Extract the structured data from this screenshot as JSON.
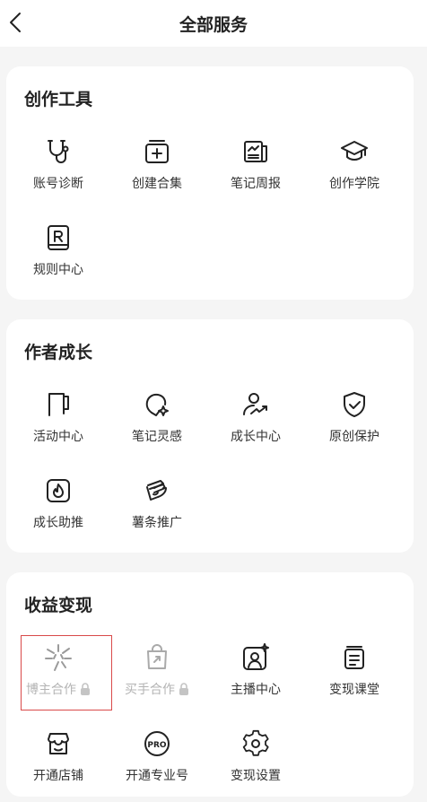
{
  "header": {
    "title": "全部服务",
    "back_icon": "chevron-left-icon"
  },
  "sections": [
    {
      "title": "创作工具",
      "items": [
        {
          "label": "账号诊断",
          "icon": "stethoscope-icon"
        },
        {
          "label": "创建合集",
          "icon": "collection-plus-icon"
        },
        {
          "label": "笔记周报",
          "icon": "report-chart-icon"
        },
        {
          "label": "创作学院",
          "icon": "graduation-cap-icon"
        },
        {
          "label": "规则中心",
          "icon": "rules-book-icon"
        }
      ]
    },
    {
      "title": "作者成长",
      "items": [
        {
          "label": "活动中心",
          "icon": "flag-icon"
        },
        {
          "label": "笔记灵感",
          "icon": "lightbulb-sparkle-icon"
        },
        {
          "label": "成长中心",
          "icon": "user-growth-icon"
        },
        {
          "label": "原创保护",
          "icon": "shield-check-icon"
        },
        {
          "label": "成长助推",
          "icon": "flame-badge-icon"
        },
        {
          "label": "薯条推广",
          "icon": "fries-icon"
        }
      ]
    },
    {
      "title": "收益变现",
      "items": [
        {
          "label": "博主合作",
          "icon": "sparkle-burst-icon",
          "locked": true
        },
        {
          "label": "买手合作",
          "icon": "shopping-bag-icon",
          "locked": true
        },
        {
          "label": "主播中心",
          "icon": "live-host-icon"
        },
        {
          "label": "变现课堂",
          "icon": "classroom-icon"
        },
        {
          "label": "开通店铺",
          "icon": "store-icon"
        },
        {
          "label": "开通专业号",
          "icon": "pro-badge-icon"
        },
        {
          "label": "变现设置",
          "icon": "gear-icon"
        }
      ]
    }
  ],
  "colors": {
    "background": "#f5f5f5",
    "card": "#ffffff",
    "text": "#222222",
    "disabled": "#b4b4b4",
    "highlight_border": "#d94a4a"
  }
}
